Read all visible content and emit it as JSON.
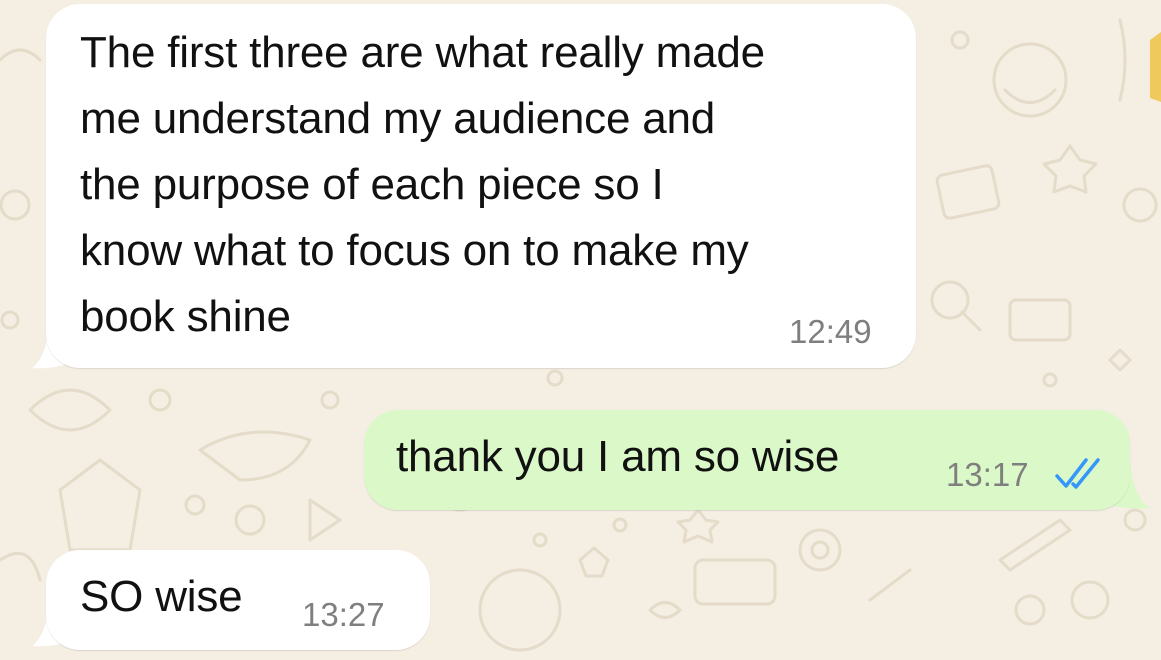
{
  "conversation": {
    "messages": [
      {
        "direction": "incoming",
        "text": "The first three are what really made\nme understand my audience and\nthe purpose of each piece so I\nknow what to focus on to make my\nbook shine",
        "time": "12:49"
      },
      {
        "direction": "outgoing",
        "text": "thank you I am so wise",
        "time": "13:17",
        "status": "read",
        "status_icon": "double-check-icon"
      },
      {
        "direction": "incoming",
        "text": "SO wise",
        "time": "13:27"
      }
    ]
  },
  "colors": {
    "wallpaper": "#f4eee3",
    "wallpaper_doodles": "#e5dccb",
    "incoming_bubble": "#ffffff",
    "outgoing_bubble": "#dbf9c8",
    "read_ticks": "#3497f9",
    "timestamp": "#7f7f7f"
  }
}
